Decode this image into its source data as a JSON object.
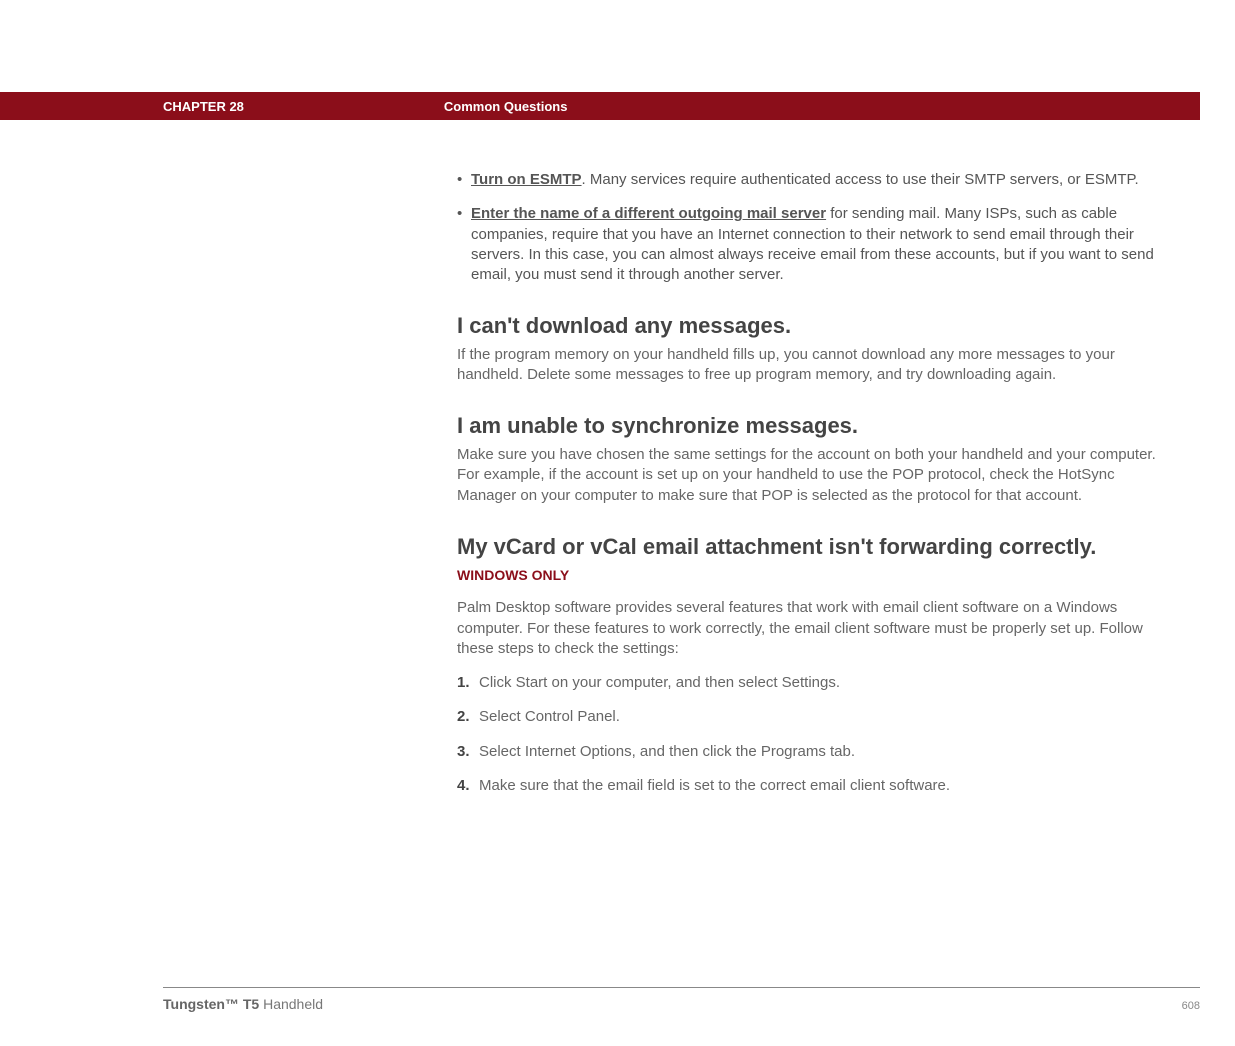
{
  "header": {
    "chapter": "CHAPTER 28",
    "section": "Common Questions"
  },
  "bullets": [
    {
      "link": "Turn on ESMTP",
      "text": ". Many services require authenticated access to use their SMTP servers, or ESMTP."
    },
    {
      "link": "Enter the name of a different outgoing mail server",
      "text": " for sending mail. Many ISPs, such as cable companies, require that you have an Internet connection to their network to send email through their servers. In this case, you can almost always receive email from these accounts, but if you want to send email, you must send it through another server."
    }
  ],
  "sections": [
    {
      "heading": "I can't download any messages.",
      "body": "If the program memory on your handheld fills up, you cannot download any more messages to your handheld. Delete some messages to free up program memory, and try downloading again."
    },
    {
      "heading": "I am unable to synchronize messages.",
      "body": "Make sure you have chosen the same settings for the account on both your handheld and your computer. For example, if the account is set up on your handheld to use the POP protocol, check the HotSync Manager on your computer to make sure that POP is selected as the protocol for that account."
    }
  ],
  "vcard": {
    "heading": "My vCard or vCal email attachment isn't forwarding correctly.",
    "subhead": "WINDOWS ONLY",
    "intro": "Palm Desktop software provides several features that work with email client software on a Windows computer. For these features to work correctly, the email client software must be properly set up. Follow these steps to check the settings:",
    "steps": [
      "Click Start on your computer, and then select Settings.",
      "Select Control Panel.",
      "Select Internet Options, and then click the Programs tab.",
      "Make sure that the email field is set to the correct email client software."
    ]
  },
  "footer": {
    "product_bold": "Tungsten™ T5",
    "product_rest": " Handheld",
    "page": "608"
  }
}
